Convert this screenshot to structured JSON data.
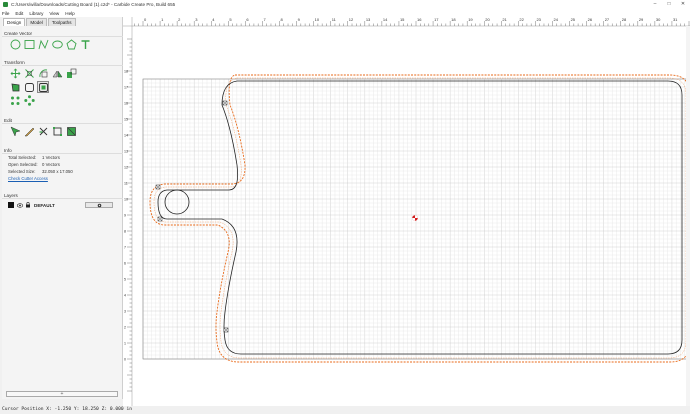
{
  "window": {
    "title": "C:/Users/willa/Downloads/Cutting Board (1).c2d* - Carbide Create Pro, Build 655",
    "minimize": "–",
    "maximize": "□",
    "close": "✕"
  },
  "menu": [
    "File",
    "Edit",
    "Library",
    "View",
    "Help"
  ],
  "tabs": [
    "Design",
    "Model",
    "Toolpaths"
  ],
  "sections": {
    "create_vector": "Create Vector",
    "transform": "Transform",
    "edit": "Edit",
    "info": "Info",
    "layers": "Layers"
  },
  "info": {
    "total_selected_label": "Total Selected:",
    "total_selected_value": "1 Vectors",
    "open_selected_label": "Open Selected:",
    "open_selected_value": "0 Vectors",
    "selected_size_label": "Selected Size:",
    "selected_size_value": "32.050 x 17.050",
    "check_cutter_access": "Check Cutter Access"
  },
  "layers": {
    "default_name": "DEFAULT",
    "add_label": "+"
  },
  "ruler": {
    "top_labels": [
      "0",
      "1",
      "2",
      "3",
      "4",
      "5",
      "6",
      "7",
      "8",
      "9",
      "10",
      "11",
      "12",
      "13",
      "14",
      "15",
      "16",
      "17",
      "18",
      "19",
      "20",
      "21",
      "22",
      "23",
      "24",
      "25",
      "26",
      "27",
      "28",
      "29",
      "30",
      "31",
      "32"
    ],
    "left_labels": [
      "18",
      "17",
      "16",
      "15",
      "14",
      "13",
      "12",
      "11",
      "10",
      "9",
      "8",
      "7",
      "6",
      "5",
      "4",
      "3",
      "2",
      "1",
      "0"
    ]
  },
  "status": {
    "cursor_position": "Cursor Position X: -1.250 Y: 18.250 Z: 0.000 in"
  },
  "colors": {
    "shape_stroke": "#222222",
    "toolpath_orange": "#e86a1a",
    "icon_green": "#3aa34a",
    "origin_red": "#d42020"
  }
}
